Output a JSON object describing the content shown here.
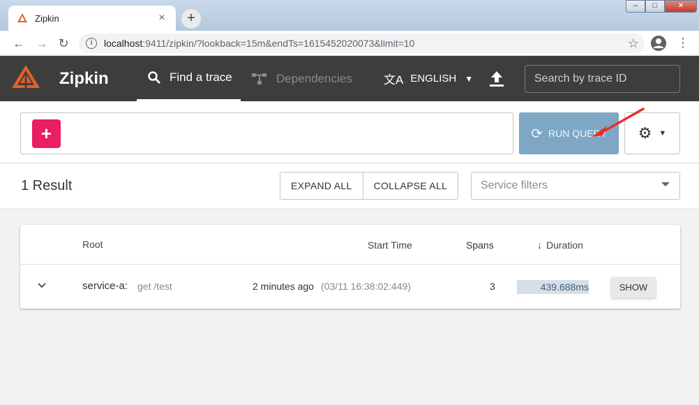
{
  "browser": {
    "tab_title": "Zipkin",
    "url_host": "localhost",
    "url_rest": ":9411/zipkin/?lookback=15m&endTs=1615452020073&limit=10",
    "window_controls": [
      "minimize-icon",
      "maximize-icon",
      "close-icon"
    ]
  },
  "app": {
    "brand": "Zipkin",
    "tabs": [
      {
        "label": "Find a trace",
        "icon": "search-icon",
        "active": true
      },
      {
        "label": "Dependencies",
        "icon": "dependencies-icon",
        "active": false
      }
    ],
    "language": "ENGLISH",
    "trace_search_placeholder": "Search by trace ID"
  },
  "query": {
    "add_label": "+",
    "run_label": "RUN QUERY"
  },
  "results": {
    "count_label": "1 Result",
    "expand_all": "EXPAND ALL",
    "collapse_all": "COLLAPSE ALL",
    "service_filter_placeholder": "Service filters",
    "columns": {
      "root": "Root",
      "start_time": "Start Time",
      "spans": "Spans",
      "duration": "Duration"
    },
    "rows": [
      {
        "service": "service-a:",
        "operation": "get /test",
        "ago": "2 minutes ago",
        "timestamp": "(03/11 16:38:02:449)",
        "spans": "3",
        "duration": "439.688ms",
        "show_label": "SHOW"
      }
    ]
  },
  "colors": {
    "appbar": "#3d3d3d",
    "accent_pink": "#e91e63",
    "run_query": "#7da7c4",
    "logo_orange": "#e2602a",
    "annotation_arrow": "#e5302a"
  }
}
